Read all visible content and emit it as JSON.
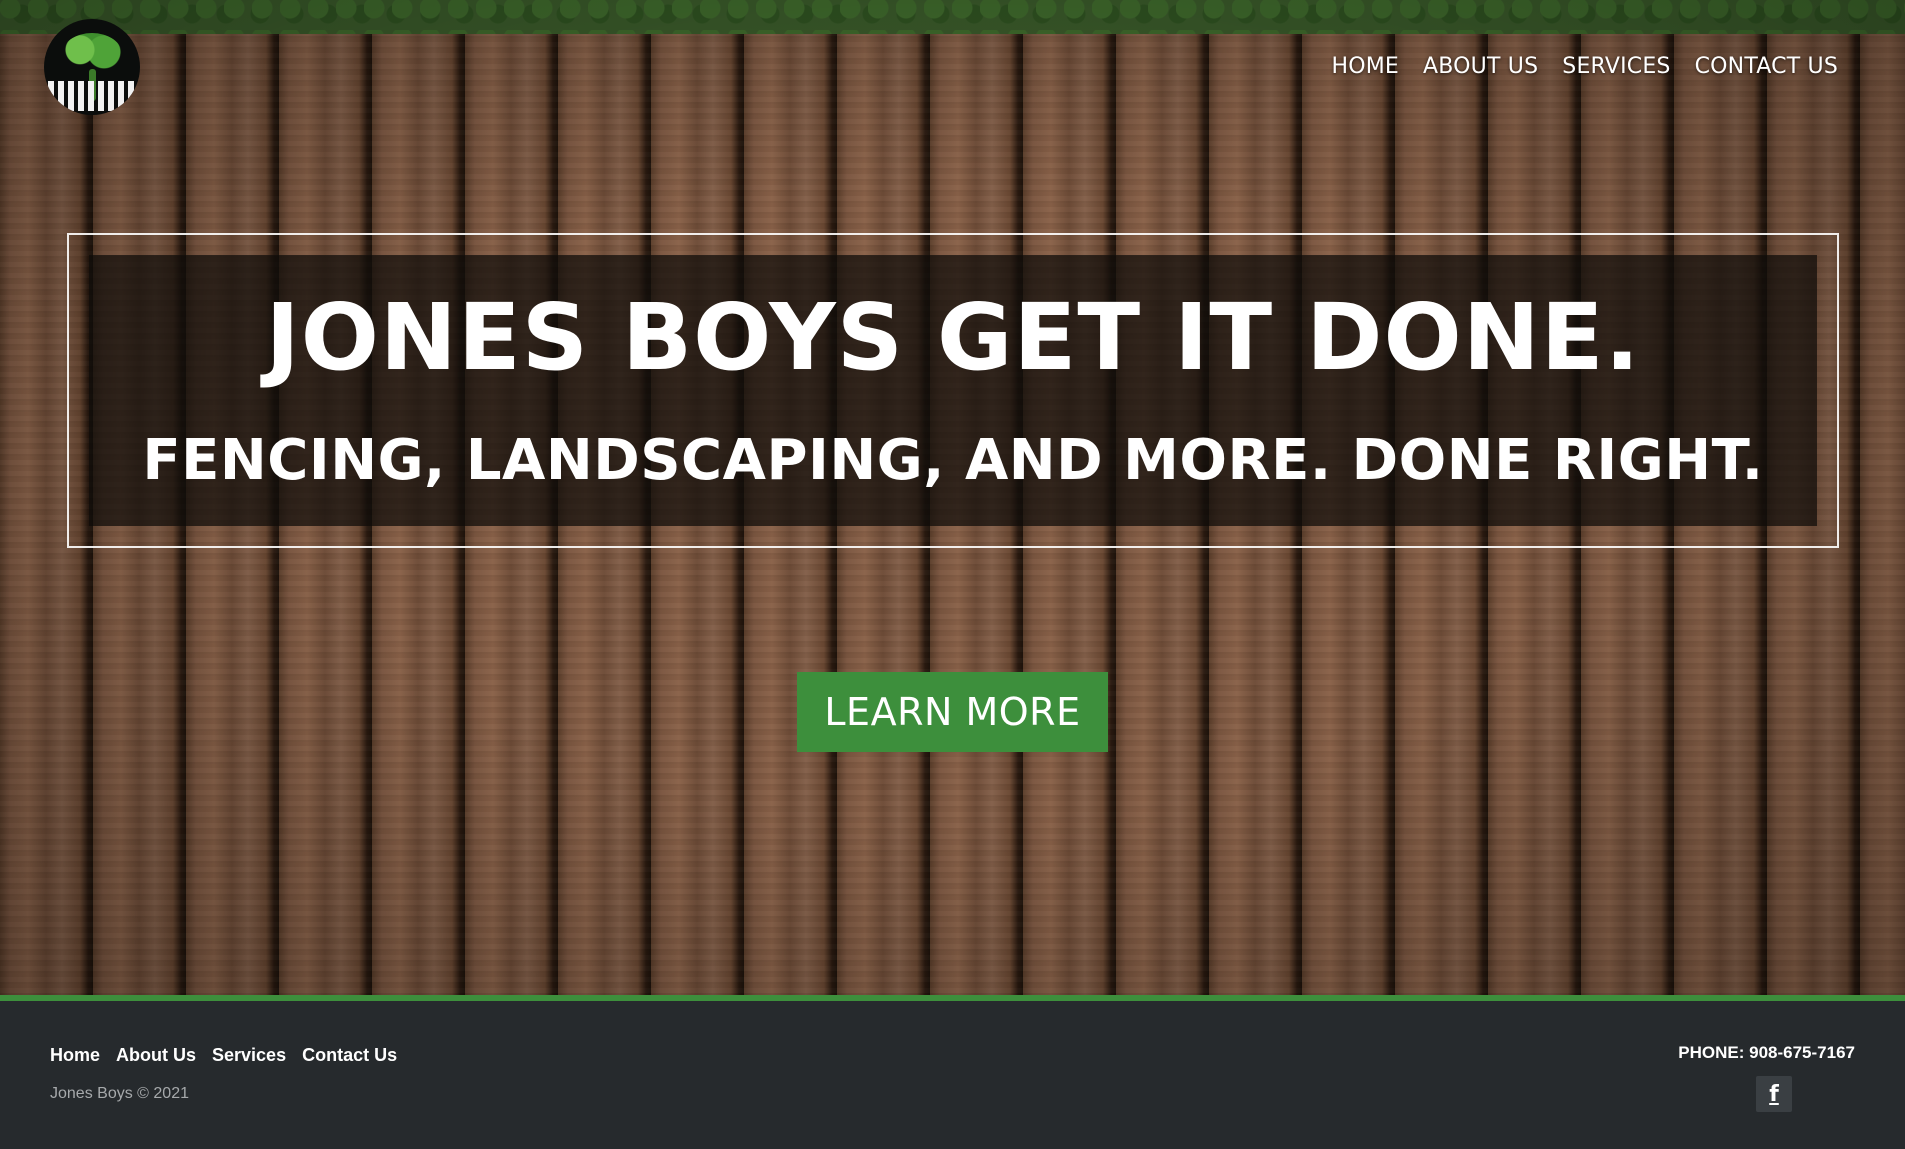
{
  "nav": {
    "items": [
      {
        "label": "HOME"
      },
      {
        "label": "ABOUT US"
      },
      {
        "label": "SERVICES"
      },
      {
        "label": "CONTACT US"
      }
    ]
  },
  "hero": {
    "headline": "JONES BOYS GET IT DONE.",
    "subheadline": "FENCING, LANDSCAPING, AND MORE. DONE RIGHT.",
    "cta_label": "LEARN MORE",
    "background": "wooden fence"
  },
  "footer": {
    "links": [
      {
        "label": "Home"
      },
      {
        "label": "About Us"
      },
      {
        "label": "Services"
      },
      {
        "label": "Contact Us"
      }
    ],
    "copyright": "Jones Boys © 2021",
    "phone": "PHONE: 908-675-7167",
    "social": {
      "facebook_glyph": "f",
      "icon": "facebook-icon"
    }
  },
  "colors": {
    "accent_green": "#3d8f3c",
    "footer_bg": "#262a2d",
    "nav_text": "#ffffff"
  },
  "logo": {
    "icon": "tree-fence-logo"
  }
}
